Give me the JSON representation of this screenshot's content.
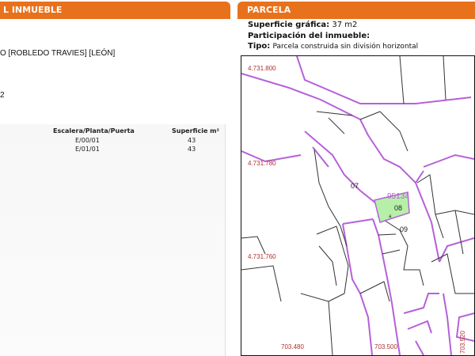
{
  "left_panel": {
    "header": "L INMUEBLE",
    "location_text": "O [ROBLEDO TRAVIES] [LEÓN]",
    "partial_value": "2",
    "table": {
      "headers": [
        "Escalera/Planta/Puerta",
        "Superficie m²"
      ],
      "rows": [
        {
          "unit": "E/00/01",
          "area": "43"
        },
        {
          "unit": "E/01/01",
          "area": "43"
        }
      ]
    }
  },
  "right_panel": {
    "header": "PARCELA",
    "fields": [
      {
        "label": "Superficie gráfica:",
        "value": "37 m2"
      },
      {
        "label": "Participación del inmueble:",
        "value": ""
      },
      {
        "label": "Tipo:",
        "value": "Parcela construida sin división horizontal"
      }
    ]
  },
  "map": {
    "colors": {
      "parcel_line": "#b561d8",
      "building_line": "#333333",
      "highlight_fill": "#b6f0a8",
      "coord_text": "#b03030",
      "parcel_code": "#b561d8"
    },
    "coord_labels": {
      "y1": "4.731.800",
      "y2": "4.731.780",
      "y3": "4.731.760",
      "x1": "703.480",
      "x2": "703.500",
      "x3": "703.520"
    },
    "parcel_code": "95134",
    "plot_labels": [
      "07",
      "08",
      "09"
    ],
    "highlight_sub": "a"
  }
}
